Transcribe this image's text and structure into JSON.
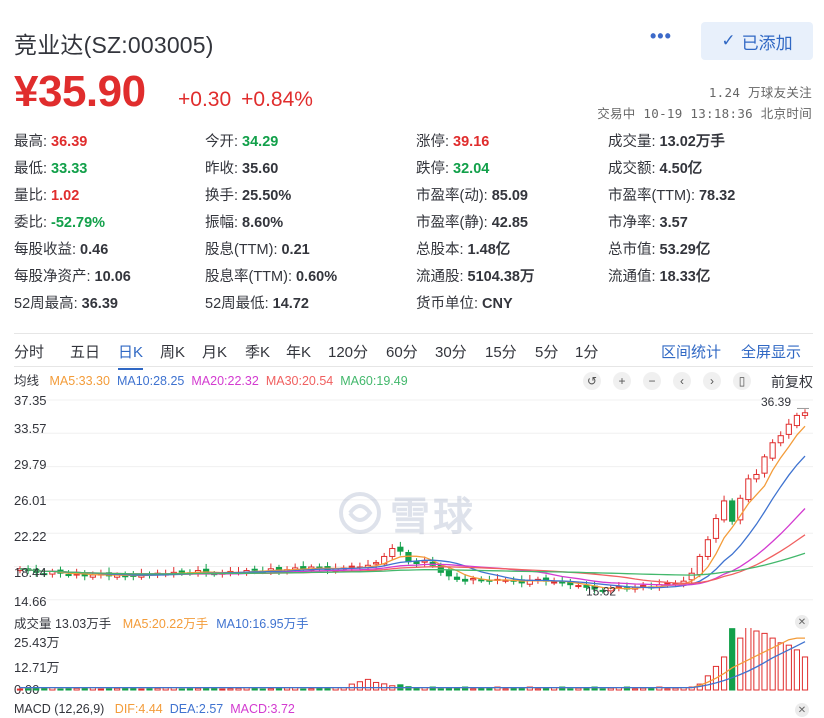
{
  "header": {
    "title": "竞业达(SZ:003005)",
    "more_label": "•••",
    "added_label": "已添加",
    "added_icon": "check-icon"
  },
  "quote": {
    "price": "¥35.90",
    "change": "+0.30",
    "change_pct": "+0.84%",
    "followers": "1.24 万球友关注",
    "status": "交易中 10-19 13:18:36 北京时间"
  },
  "stats": [
    {
      "label": "最高:",
      "value": "36.39",
      "color": "red"
    },
    {
      "label": "今开:",
      "value": "34.29",
      "color": "green"
    },
    {
      "label": "涨停:",
      "value": "39.16",
      "color": "red"
    },
    {
      "label": "成交量:",
      "value": "13.02万手",
      "color": "plain"
    },
    {
      "label": "最低:",
      "value": "33.33",
      "color": "green"
    },
    {
      "label": "昨收:",
      "value": "35.60",
      "color": "plain"
    },
    {
      "label": "跌停:",
      "value": "32.04",
      "color": "green"
    },
    {
      "label": "成交额:",
      "value": "4.50亿",
      "color": "plain"
    },
    {
      "label": "量比:",
      "value": "1.02",
      "color": "red"
    },
    {
      "label": "换手:",
      "value": "25.50%",
      "color": "plain"
    },
    {
      "label": "市盈率(动):",
      "value": "85.09",
      "color": "plain"
    },
    {
      "label": "市盈率(TTM):",
      "value": "78.32",
      "color": "plain"
    },
    {
      "label": "委比:",
      "value": "-52.79%",
      "color": "green"
    },
    {
      "label": "振幅:",
      "value": "8.60%",
      "color": "plain"
    },
    {
      "label": "市盈率(静):",
      "value": "42.85",
      "color": "plain"
    },
    {
      "label": "市净率:",
      "value": "3.57",
      "color": "plain"
    },
    {
      "label": "每股收益:",
      "value": "0.46",
      "color": "plain"
    },
    {
      "label": "股息(TTM):",
      "value": "0.21",
      "color": "plain"
    },
    {
      "label": "总股本:",
      "value": "1.48亿",
      "color": "plain"
    },
    {
      "label": "总市值:",
      "value": "53.29亿",
      "color": "plain"
    },
    {
      "label": "每股净资产:",
      "value": "10.06",
      "color": "plain"
    },
    {
      "label": "股息率(TTM):",
      "value": "0.60%",
      "color": "plain"
    },
    {
      "label": "流通股:",
      "value": "5104.38万",
      "color": "plain"
    },
    {
      "label": "流通值:",
      "value": "18.33亿",
      "color": "plain"
    },
    {
      "label": "52周最高:",
      "value": "36.39",
      "color": "plain"
    },
    {
      "label": "52周最低:",
      "value": "14.72",
      "color": "plain"
    },
    {
      "label": "货币单位:",
      "value": "CNY",
      "color": "plain"
    }
  ],
  "tabs": [
    "分时",
    "五日",
    "日K",
    "周K",
    "月K",
    "季K",
    "年K",
    "120分",
    "60分",
    "30分",
    "15分",
    "5分",
    "1分"
  ],
  "active_tab": "日K",
  "tab_actions": [
    "区间统计",
    "全屏显示"
  ],
  "kline": {
    "ma_title": "均线",
    "ma": [
      {
        "label": "MA5:33.30",
        "color": "#f39c3a"
      },
      {
        "label": "MA10:28.25",
        "color": "#3f73d0"
      },
      {
        "label": "MA20:22.32",
        "color": "#d33bd0"
      },
      {
        "label": "MA30:20.54",
        "color": "#f06060"
      },
      {
        "label": "MA60:19.49",
        "color": "#43b86c"
      }
    ],
    "controls": [
      "↺",
      "+",
      "−",
      "‹",
      "›",
      "▯"
    ],
    "adjust_label": "前复权",
    "y_ticks": [
      "37.35",
      "33.57",
      "29.79",
      "26.01",
      "22.22",
      "18.44",
      "14.66"
    ],
    "max_label": "36.39",
    "min_label": "15.62",
    "watermark": "雪球"
  },
  "volume": {
    "title": "成交量 13.03万手",
    "ma": [
      {
        "label": "MA5:20.22万手",
        "color": "#f39c3a"
      },
      {
        "label": "MA10:16.95万手",
        "color": "#3f73d0"
      }
    ],
    "y_ticks": [
      "25.43万",
      "12.71万",
      "0.00"
    ]
  },
  "macd": {
    "title": "MACD (12,26,9)",
    "items": [
      {
        "label": "DIF:4.44",
        "color": "#f39c3a"
      },
      {
        "label": "DEA:2.57",
        "color": "#3f73d0"
      },
      {
        "label": "MACD:3.72",
        "color": "#d33bd0"
      }
    ]
  },
  "chart_data": {
    "type": "candlestick",
    "ylim": [
      14.66,
      37.35
    ],
    "grid": true,
    "closes": [
      18.2,
      18.0,
      17.8,
      17.6,
      17.9,
      17.7,
      17.5,
      17.6,
      17.4,
      17.5,
      17.6,
      17.4,
      17.5,
      17.3,
      17.4,
      17.6,
      17.5,
      17.7,
      17.6,
      17.8,
      17.9,
      17.7,
      18.0,
      17.8,
      17.6,
      17.7,
      17.9,
      17.8,
      18.0,
      18.1,
      17.9,
      18.2,
      18.0,
      18.1,
      18.3,
      18.2,
      18.4,
      18.3,
      18.1,
      18.2,
      18.3,
      18.5,
      18.4,
      18.6,
      18.9,
      19.6,
      20.5,
      20.2,
      19.0,
      18.8,
      19.1,
      18.6,
      17.8,
      17.4,
      17.0,
      16.8,
      17.1,
      16.9,
      16.8,
      17.0,
      16.9,
      16.8,
      16.6,
      16.9,
      17.0,
      16.8,
      16.7,
      16.6,
      16.4,
      16.3,
      16.1,
      15.9,
      15.7,
      16.0,
      16.2,
      15.9,
      16.1,
      16.3,
      16.1,
      16.4,
      16.6,
      16.5,
      16.8,
      17.7,
      19.6,
      21.5,
      23.9,
      25.9,
      23.6,
      26.2,
      28.4,
      28.9,
      30.9,
      32.5,
      33.3,
      34.6,
      35.6,
      35.9
    ],
    "ma5_last": 33.3,
    "ma10_last": 28.25,
    "ma20_last": 22.32,
    "ma30_last": 20.54,
    "ma60_last": 19.49,
    "volume_max_wan": 25.43
  }
}
